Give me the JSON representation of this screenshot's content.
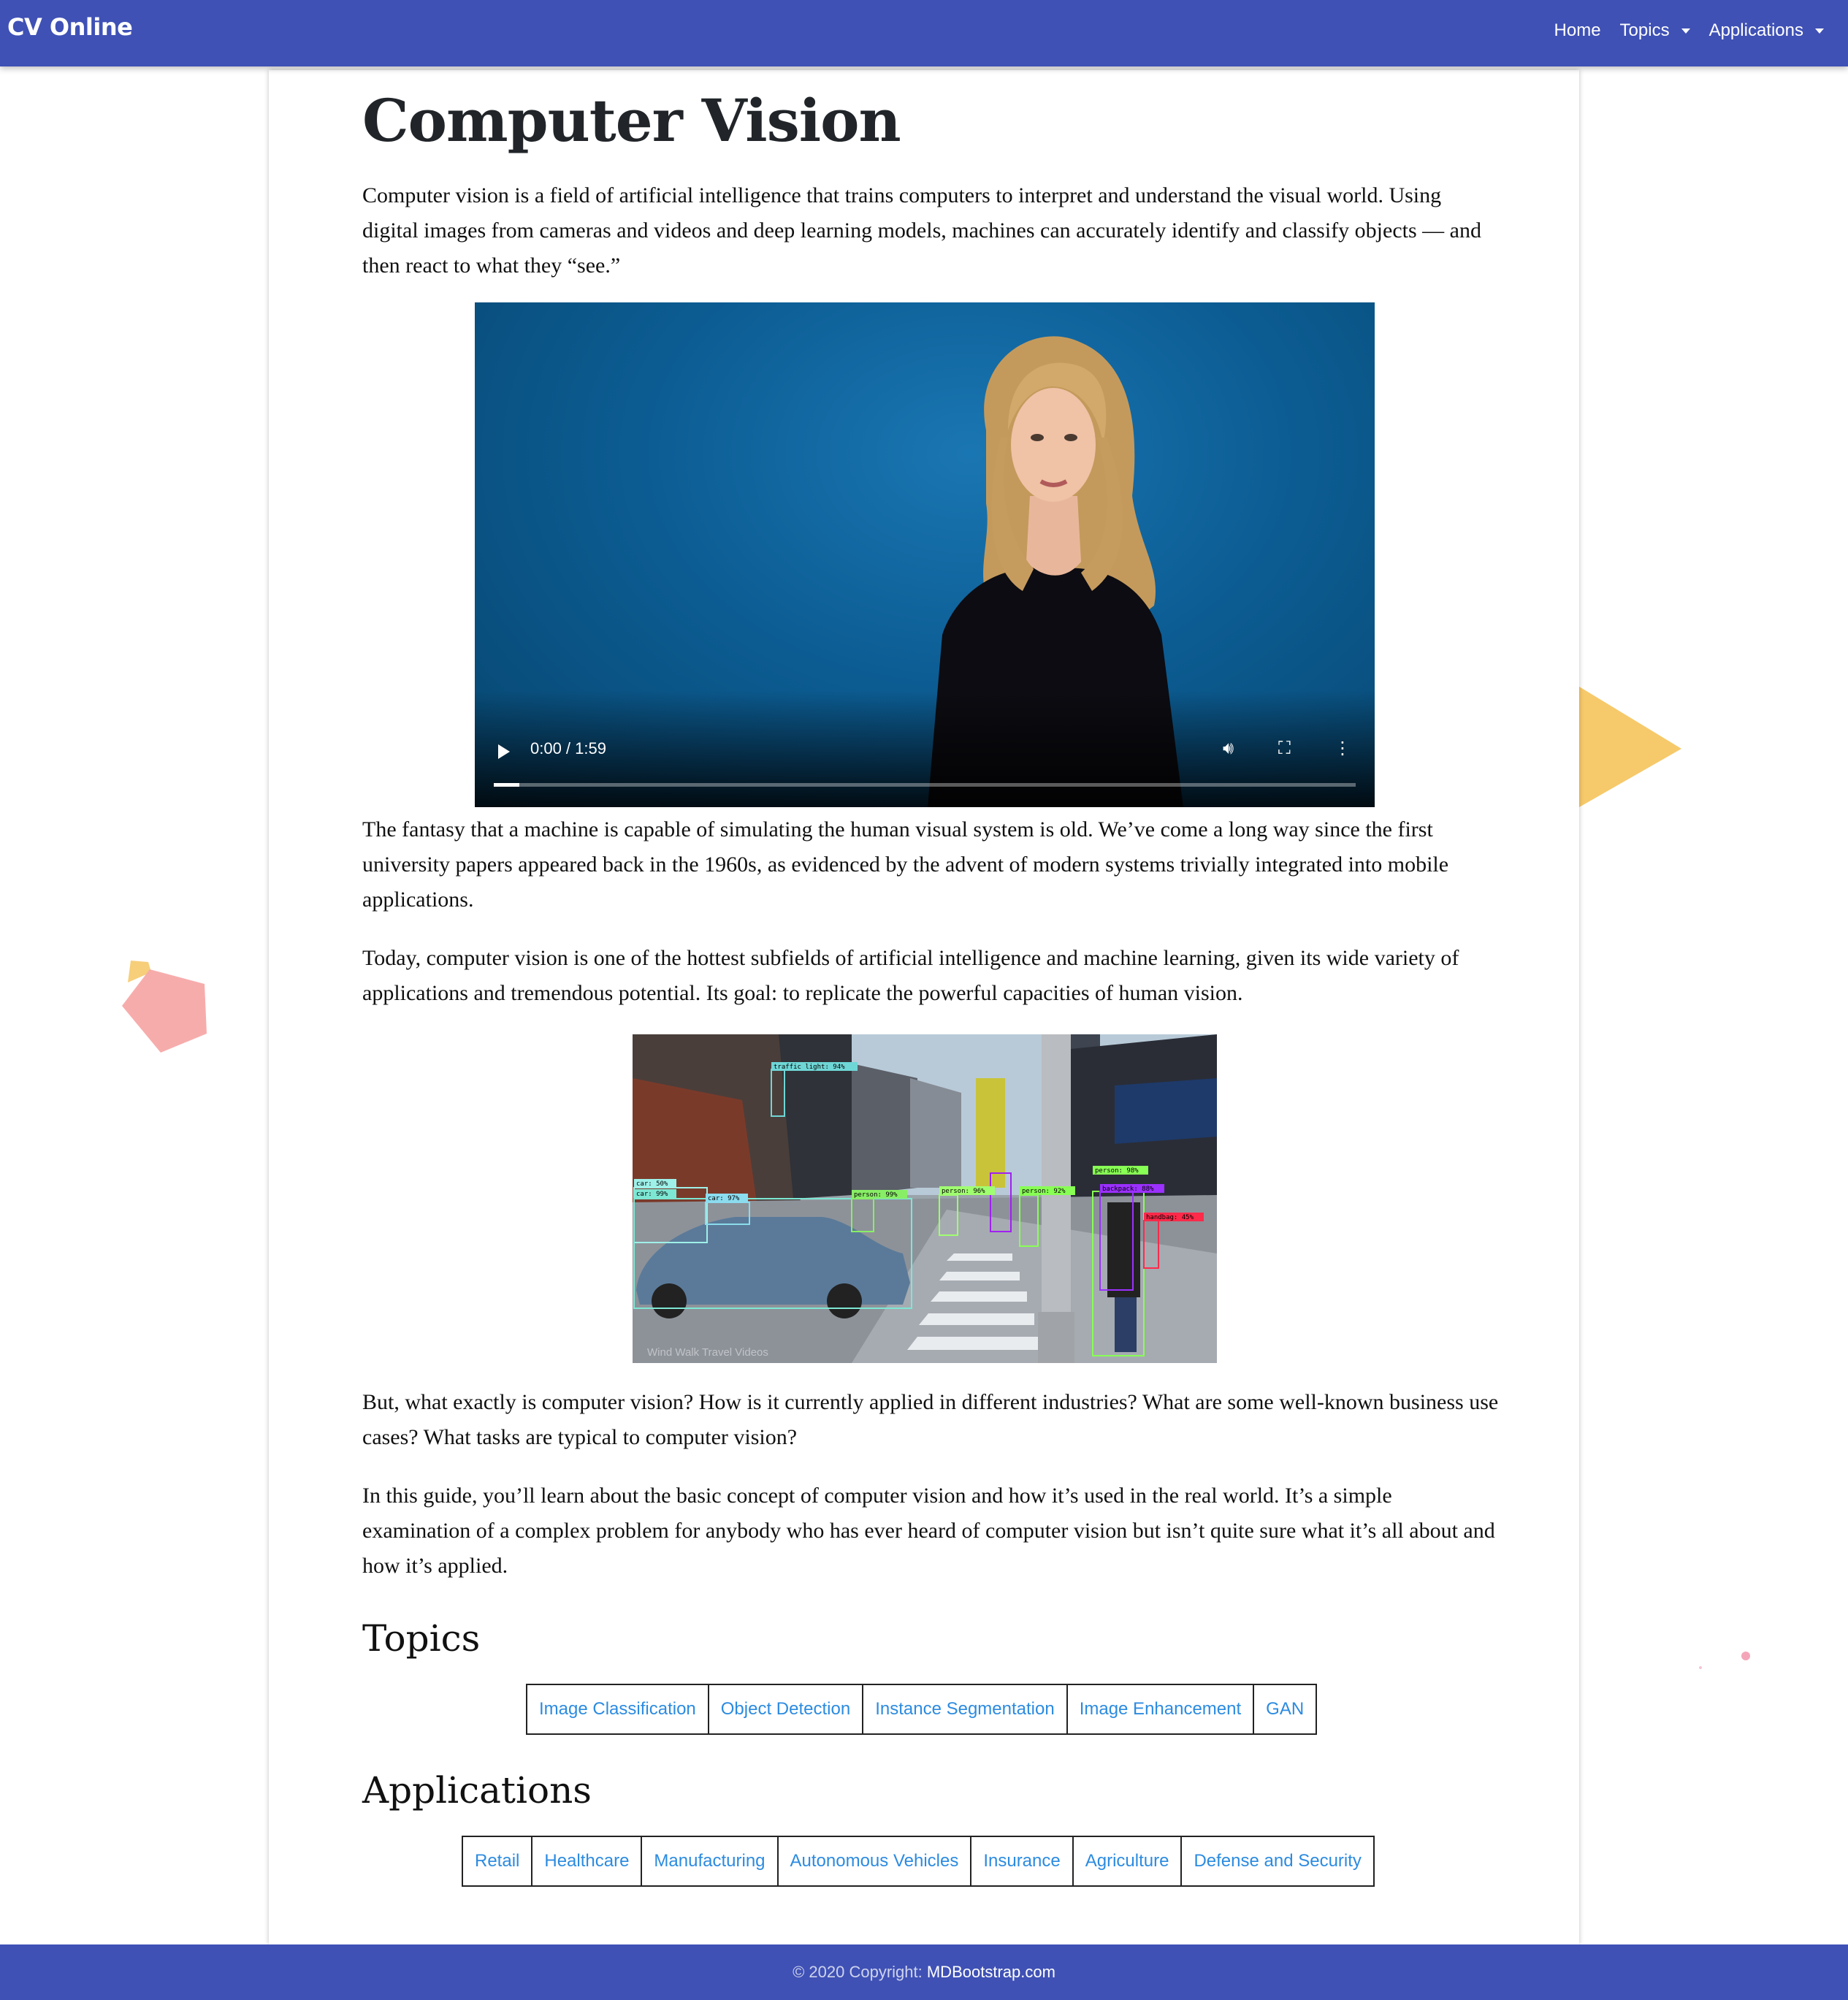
{
  "navbar": {
    "brand": "CV Online",
    "links": [
      {
        "label": "Home"
      },
      {
        "label": "Topics"
      },
      {
        "label": "Applications"
      }
    ]
  },
  "article": {
    "title": "Computer Vision",
    "intro": "Computer vision is a field of artificial intelligence that trains computers to interpret and understand the visual world. Using digital images from cameras and videos and deep learning models, machines can accurately identify and classify objects — and then react to what they “see.”",
    "para2": "The fantasy that a machine is capable of simulating the human visual system is old. We’ve come a long way since the first university papers appeared back in the 1960s, as evidenced by the advent of modern systems trivially integrated into mobile applications.",
    "para3": "Today, computer vision is one of the hottest subfields of artificial intelligence and machine learning, given its wide variety of applications and tremendous potential. Its goal: to replicate the powerful capacities of human vision.",
    "para4": "But, what exactly is computer vision? How is it currently applied in different industries? What are some well-known business use cases? What tasks are typical to computer vision?",
    "para5": "In this guide, you’ll learn about the basic concept of computer vision and how it’s used in the real world. It’s a simple examination of a complex problem for anybody who has ever heard of computer vision but isn’t quite sure what it’s all about and how it’s applied."
  },
  "video": {
    "time": "0:00 / 1:59",
    "progress": 0.03,
    "icons": [
      "play-icon",
      "volume-icon",
      "fullscreen-icon",
      "more-options-icon"
    ]
  },
  "street_image": {
    "labels": [
      "traffic light: 94%",
      "car: 50%",
      "car: 99%",
      "car: 97%",
      "person: 99%",
      "person: 96%",
      "person: 92%",
      "person: 98%",
      "backpack: 88%",
      "handbag: 45%"
    ],
    "watermark": "Wind Walk Travel Videos"
  },
  "topics": {
    "heading": "Topics",
    "items": [
      "Image Classification",
      "Object Detection",
      "Instance Segmentation",
      "Image Enhancement",
      "GAN"
    ]
  },
  "applications": {
    "heading": "Applications",
    "items": [
      "Retail",
      "Healthcare",
      "Manufacturing",
      "Autonomous Vehicles",
      "Insurance",
      "Agriculture",
      "Defense and Security"
    ]
  },
  "footer": {
    "copyright": "© 2020 Copyright:",
    "link": "MDBootstrap.com"
  },
  "colors": {
    "navbar": "#3f51b5",
    "link": "#2c8be0",
    "deco_triangle": "#f6c96a",
    "deco_pentagon": "#f7a8a8"
  }
}
